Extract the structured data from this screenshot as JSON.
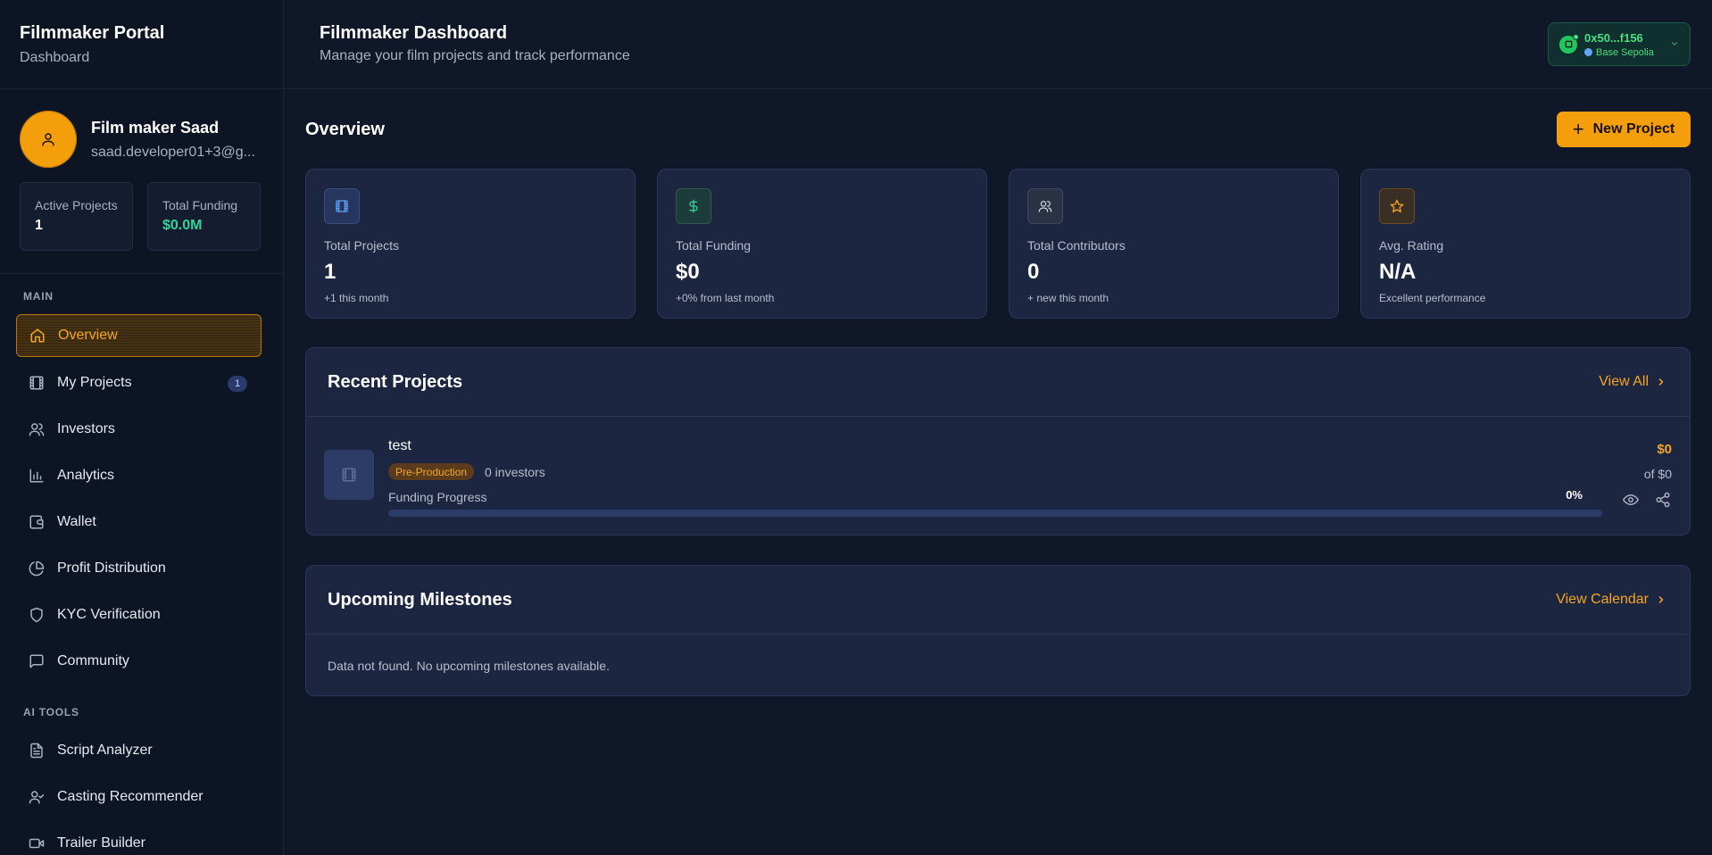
{
  "sidebar": {
    "title": "Filmmaker Portal",
    "subtitle": "Dashboard",
    "profile": {
      "name": "Film maker Saad",
      "email": "saad.developer01+3@g..."
    },
    "mini_stats": [
      {
        "label": "Active Projects",
        "value": "1"
      },
      {
        "label": "Total Funding",
        "value": "$0.0M"
      }
    ],
    "sections": {
      "main": "MAIN",
      "ai_tools": "AI TOOLS"
    },
    "main_items": [
      {
        "label": "Overview",
        "icon": "home-icon",
        "active": true
      },
      {
        "label": "My Projects",
        "icon": "film-icon",
        "badge": "1"
      },
      {
        "label": "Investors",
        "icon": "users-icon"
      },
      {
        "label": "Analytics",
        "icon": "bar-chart-icon"
      },
      {
        "label": "Wallet",
        "icon": "wallet-icon"
      },
      {
        "label": "Profit Distribution",
        "icon": "pie-chart-icon"
      },
      {
        "label": "KYC Verification",
        "icon": "shield-icon"
      },
      {
        "label": "Community",
        "icon": "message-square-icon"
      }
    ],
    "ai_items": [
      {
        "label": "Script Analyzer",
        "icon": "file-text-icon"
      },
      {
        "label": "Casting Recommender",
        "icon": "user-check-icon"
      },
      {
        "label": "Trailer Builder",
        "icon": "video-icon"
      }
    ]
  },
  "header": {
    "title": "Filmmaker Dashboard",
    "subtitle": "Manage your film projects and track performance",
    "wallet": {
      "address": "0x50...f156",
      "network": "Base Sepolia"
    }
  },
  "overview": {
    "title": "Overview",
    "new_project_label": "New Project",
    "stats": [
      {
        "label": "Total Projects",
        "value": "1",
        "note": "+1 this month",
        "icon": "film-icon",
        "accent": "#60a5fa"
      },
      {
        "label": "Total Funding",
        "value": "$0",
        "note": "+0% from last month",
        "icon": "dollar-icon",
        "accent": "#34d399"
      },
      {
        "label": "Total Contributors",
        "value": "0",
        "note": "+ new this month",
        "icon": "users-icon",
        "accent": "#c9cfdb"
      },
      {
        "label": "Avg. Rating",
        "value": "N/A",
        "note": "Excellent performance",
        "icon": "star-icon",
        "accent": "#f5a524"
      }
    ]
  },
  "recent_projects": {
    "title": "Recent Projects",
    "view_all_label": "View All",
    "items": [
      {
        "name": "test",
        "status": "Pre-Production",
        "investors": "0 investors",
        "progress_label": "Funding Progress",
        "progress_text": "0%",
        "progress": 0,
        "raised": "$0",
        "goal": "of $0"
      }
    ]
  },
  "milestones": {
    "title": "Upcoming Milestones",
    "view_calendar_label": "View Calendar",
    "empty_message": "Data not found. No upcoming milestones available."
  },
  "colors": {
    "accent": "#f59e0b",
    "background": "#0f1729",
    "card": "#1c2641",
    "success": "#34d399"
  }
}
